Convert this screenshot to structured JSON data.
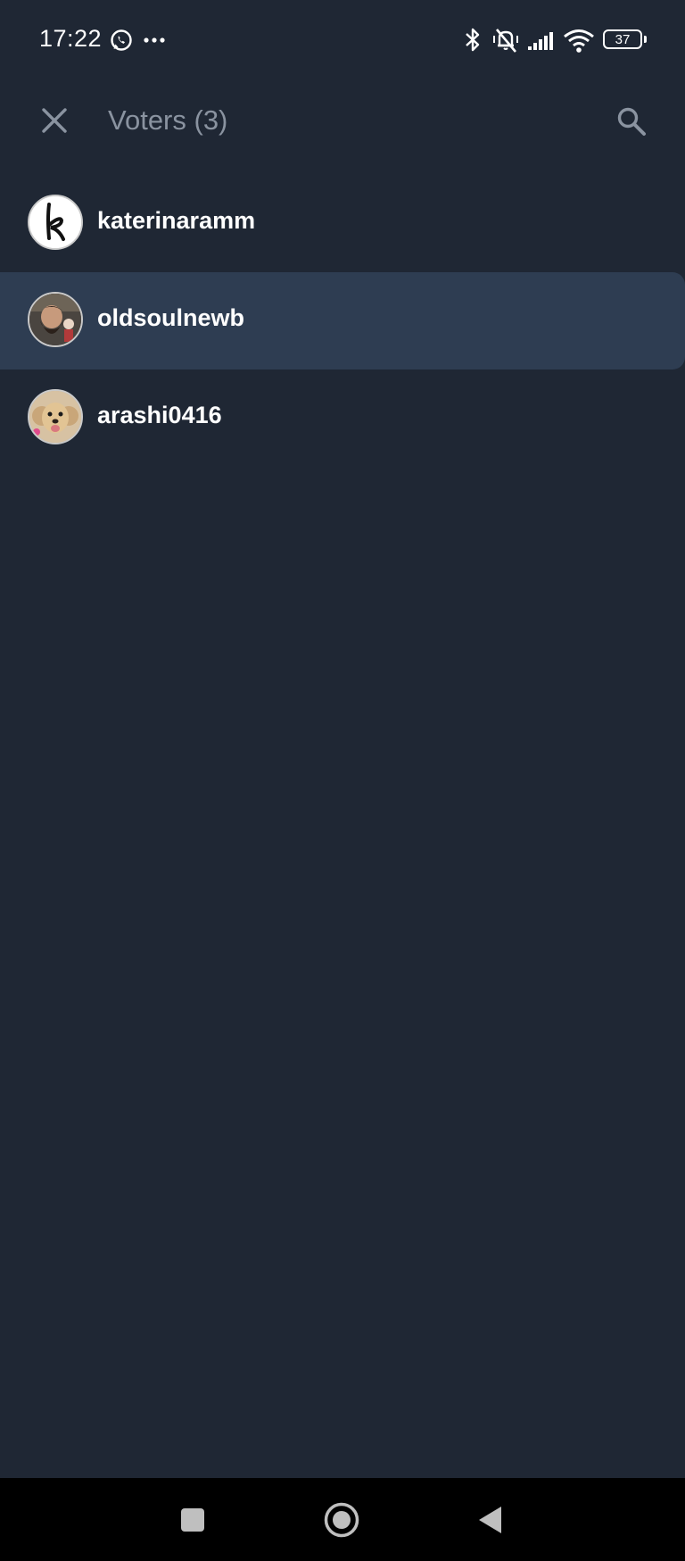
{
  "status_bar": {
    "time": "17:22",
    "battery_level": "37",
    "icons": [
      "whatsapp-icon",
      "more-dots-icon",
      "bluetooth-icon",
      "vibrate-off-icon",
      "cellular-signal-icon",
      "wifi-icon",
      "battery-icon"
    ]
  },
  "header": {
    "title": "Voters (3)",
    "close_icon": "close-icon",
    "search_icon": "search-icon"
  },
  "voters": [
    {
      "username": "katerinaramm",
      "avatar": "letter-k-avatar",
      "selected": false
    },
    {
      "username": "oldsoulnewb",
      "avatar": "bearded-man-avatar",
      "selected": true
    },
    {
      "username": "arashi0416",
      "avatar": "dog-avatar",
      "selected": false
    }
  ],
  "nav_bar": {
    "icons": [
      "recents-square-icon",
      "home-circle-icon",
      "back-triangle-icon"
    ]
  },
  "colors": {
    "background": "#1f2734",
    "selected_row": "#2e3d52",
    "title_text": "#8a93a0",
    "primary_text": "#ffffff",
    "nav_background": "#000000"
  }
}
